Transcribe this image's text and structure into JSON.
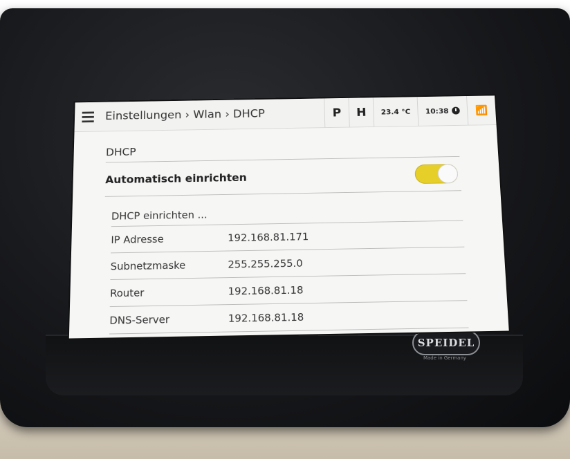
{
  "topbar": {
    "breadcrumb": "Einstellungen › Wlan › DHCP",
    "p_label": "P",
    "h_label": "H",
    "temperature": "23.4 °C",
    "time": "10:38",
    "menu_icon": "hamburger-icon",
    "clock_icon": "clock-icon",
    "wifi_icon": "wifi-icon"
  },
  "section": {
    "title": "DHCP",
    "toggle_label": "Automatisch einrichten",
    "toggle_on": true,
    "toggle_color": "#e7cf2a",
    "subsection_title": "DHCP einrichten ..."
  },
  "rows": [
    {
      "label": "IP Adresse",
      "value": "192.168.81.171"
    },
    {
      "label": "Subnetzmaske",
      "value": "255.255.255.0"
    },
    {
      "label": "Router",
      "value": "192.168.81.18"
    },
    {
      "label": "DNS-Server",
      "value": "192.168.81.18"
    }
  ],
  "device": {
    "brand": "SPEIDEL",
    "tagline": "Made in Germany"
  }
}
